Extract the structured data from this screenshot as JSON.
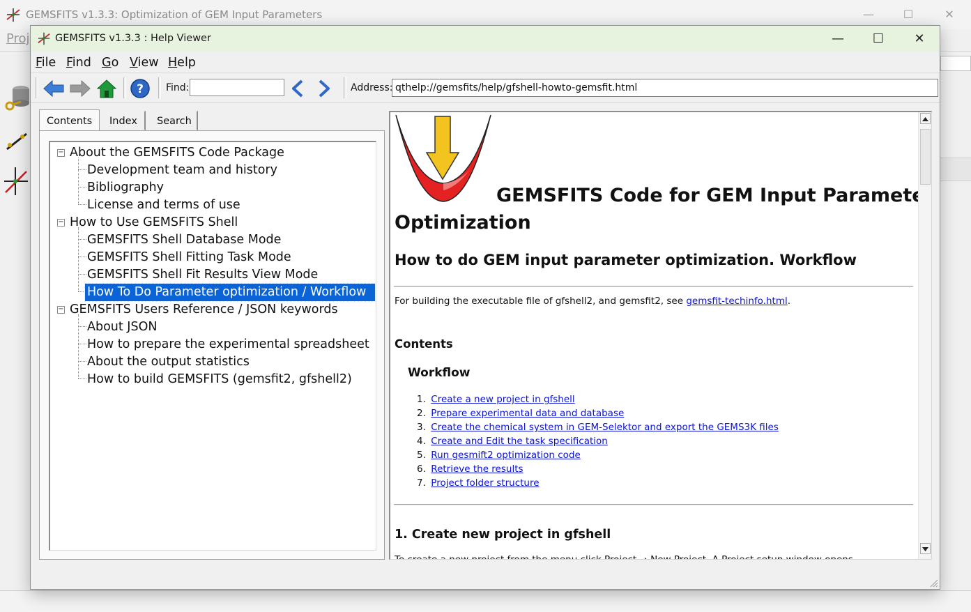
{
  "background_window": {
    "title": "GEMSFITS v1.3.3: Optimization of GEM Input Parameters",
    "menu_partial": "Proj",
    "controls": {
      "minimize": "—",
      "maximize": "☐",
      "close": "✕"
    }
  },
  "help_window": {
    "title": "GEMSFITS v1.3.3 : Help Viewer",
    "controls": {
      "minimize": "—",
      "maximize": "☐",
      "close": "✕"
    },
    "menu": {
      "file": {
        "accel": "F",
        "rest": "ile"
      },
      "find": {
        "accel": "F",
        "rest": "ind"
      },
      "go": {
        "accel": "G",
        "rest": "o"
      },
      "view": {
        "accel": "V",
        "rest": "iew"
      },
      "help": {
        "accel": "H",
        "rest": "elp"
      }
    },
    "toolbar": {
      "icons": [
        "back-arrow-icon",
        "forward-arrow-icon",
        "home-icon",
        "help-icon",
        "find-previous-icon",
        "find-next-icon"
      ],
      "find_label": "Find:",
      "find_value": "",
      "address_label": "Address:",
      "address_value": "qthelp://gemsfits/help/gfshell-howto-gemsfit.html"
    },
    "tabs": [
      "Contents",
      "Index",
      "Search"
    ],
    "active_tab": "Contents",
    "tree": {
      "groups": [
        {
          "label": "About the GEMSFITS Code Package",
          "children": [
            "Development team and history",
            "Bibliography",
            "License and terms of use"
          ]
        },
        {
          "label": "How to Use GEMSFITS Shell",
          "children": [
            "GEMSFITS Shell Database Mode",
            "GEMSFITS Shell Fitting Task Mode",
            "GEMSFITS Shell Fit Results View Mode",
            "How To Do Parameter optimization / Workflow"
          ]
        },
        {
          "label": "GEMSFITS Users Reference / JSON keywords",
          "children": [
            "About JSON",
            "How to prepare the experimental spreadsheet",
            "About the output statistics",
            "How to build GEMSFITS (gemsfit2, gfshell2)"
          ]
        }
      ],
      "selected": "How To Do Parameter optimization / Workflow"
    },
    "document": {
      "title_line1": "GEMSFITS Code for GEM Input Parameter",
      "title_line2": "Optimization",
      "heading": "How to do GEM input parameter optimization. Workflow",
      "intro_text": "For building the executable file of gfshell2, and gemsfit2, see ",
      "intro_link": "gemsfit-techinfo.html",
      "intro_end": ".",
      "contents_heading": "Contents",
      "workflow_heading": "Workflow",
      "toc": [
        "Create a new project in gfshell",
        "Prepare experimental data and database",
        "Create the chemical system in GEM-Selektor and export the GEMS3K files",
        "Create and Edit the task specification",
        "Run gesmift2 optimization code",
        "Retrieve the results",
        "Project folder structure"
      ],
      "section1_heading": "1. Create new project in gfshell",
      "cut_text": "To create a new project from the menu click Project → New Project. A Project setup window opens"
    }
  },
  "colors": {
    "titlebar_active": "#e8f3df",
    "selection": "#0a64d8",
    "link": "#0b13d6"
  }
}
